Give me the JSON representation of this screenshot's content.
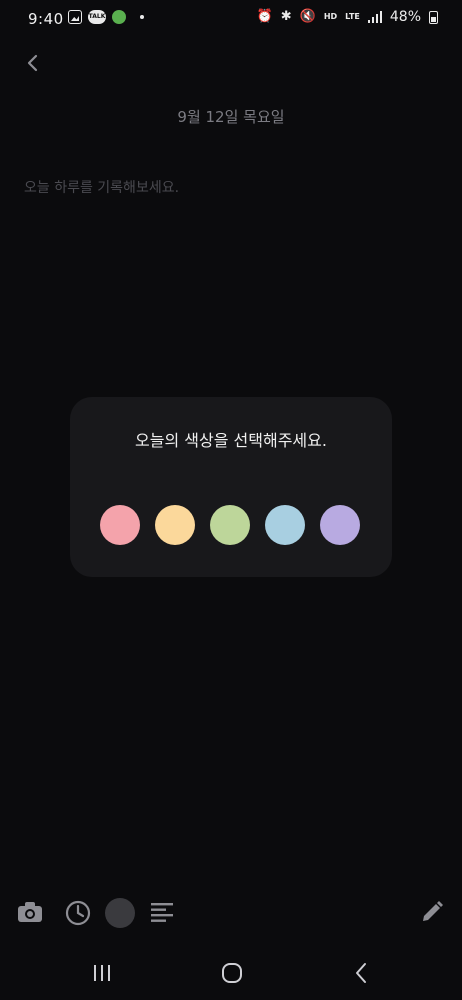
{
  "status_bar": {
    "time": "9:40",
    "notifications": [
      "gallery-icon",
      "kakaotalk-icon",
      "smile-app-icon"
    ],
    "talk_label": "TALK",
    "hd_label": "HD",
    "lte_label": "LTE",
    "battery_percent": "48%"
  },
  "header": {
    "date": "9월 12일 목요일"
  },
  "editor": {
    "placeholder": "오늘 하루를 기록해보세요."
  },
  "color_dialog": {
    "title": "오늘의 색상을 선택해주세요.",
    "colors": [
      {
        "name": "pink",
        "hex": "#f4a3ab"
      },
      {
        "name": "yellow",
        "hex": "#fbd89b"
      },
      {
        "name": "green",
        "hex": "#bdd69a"
      },
      {
        "name": "blue",
        "hex": "#a8cfe1"
      },
      {
        "name": "purple",
        "hex": "#b8aae1"
      }
    ]
  },
  "toolbar": {
    "icons": [
      "camera-icon",
      "clock-icon",
      "color-circle",
      "align-icon",
      "pencil-icon"
    ],
    "color_circle_hex": "#3a3a3e"
  },
  "nav": {
    "icons": [
      "recent-apps-icon",
      "home-icon",
      "back-icon"
    ]
  }
}
